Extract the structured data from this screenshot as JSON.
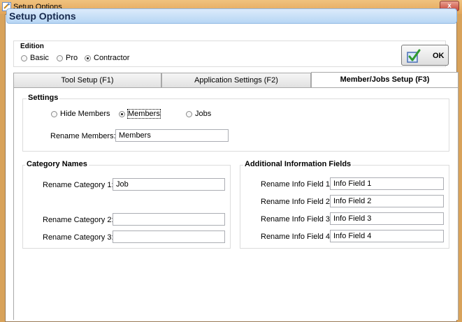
{
  "window": {
    "title": "Setup Options",
    "close_glyph": "x",
    "icon": "setup-options-app-icon"
  },
  "banner": {
    "title": "Setup Options"
  },
  "edition": {
    "label": "Edition",
    "options": [
      {
        "label": "Basic",
        "selected": false
      },
      {
        "label": "Pro",
        "selected": false
      },
      {
        "label": "Contractor",
        "selected": true
      }
    ]
  },
  "ok_button": {
    "label": "OK",
    "icon": "checkmark-icon"
  },
  "tabs": [
    {
      "label": "Tool Setup (F1)",
      "active": false
    },
    {
      "label": "Application Settings (F2)",
      "active": false
    },
    {
      "label": "Member/Jobs Setup (F3)",
      "active": true
    }
  ],
  "settings": {
    "title": "Settings",
    "options": [
      {
        "label": "Hide Members",
        "selected": false
      },
      {
        "label": "Members",
        "selected": true
      },
      {
        "label": "Jobs",
        "selected": false
      }
    ],
    "rename_label": "Rename Members:",
    "rename_value": "Members"
  },
  "category_names": {
    "title": "Category Names",
    "fields": [
      {
        "label": "Rename Category 1:",
        "value": "Job"
      },
      {
        "label": "Rename Category 2:",
        "value": ""
      },
      {
        "label": "Rename Category 3:",
        "value": ""
      }
    ]
  },
  "info_fields": {
    "title": "Additional Information Fields",
    "fields": [
      {
        "label": "Rename Info Field 1:",
        "value": "Info Field 1"
      },
      {
        "label": "Rename Info Field 2:",
        "value": "Info Field 2"
      },
      {
        "label": "Rename Info Field 3:",
        "value": "Info Field 3"
      },
      {
        "label": "Rename Info Field 4:",
        "value": "Info Field 4"
      }
    ]
  },
  "colors": {
    "title_bar": "#e2a55a",
    "banner": "#b7d6f4",
    "banner_text": "#17294d",
    "close_button": "#c6463a"
  }
}
